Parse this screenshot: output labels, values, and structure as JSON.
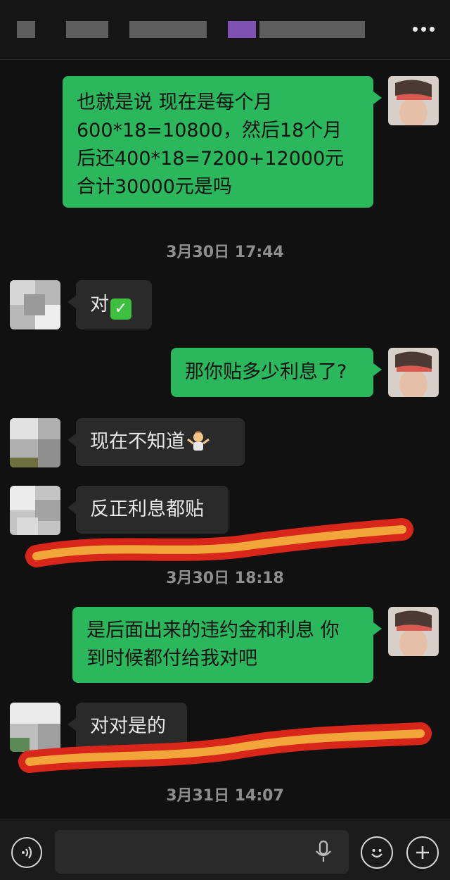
{
  "header": {
    "more_icon": "more-dots-icon"
  },
  "messages": [
    {
      "side": "self",
      "text": "也就是说 现在是每个月\n600*18=10800，然后18个月\n后还400*18=7200+12000元\n合计30000元是吗"
    },
    {
      "side": "other",
      "text": "对"
    },
    {
      "side": "self",
      "text": "那你贴多少利息了?"
    },
    {
      "side": "other",
      "text": "现在不知道"
    },
    {
      "side": "other",
      "text": "反正利息都贴"
    },
    {
      "side": "self",
      "text": "是后面出来的违约金和利息 你\n到时候都付给我对吧"
    },
    {
      "side": "other",
      "text": "对对是的"
    }
  ],
  "timestamps": [
    "3月30日 17:44",
    "3月30日 18:18",
    "3月31日 14:07"
  ],
  "input_bar": {
    "placeholder": "",
    "voice_icon": "voice-mode-icon",
    "mic_icon": "microphone-icon",
    "emoji_icon": "emoji-icon",
    "plus_icon": "plus-icon"
  },
  "colors": {
    "self_bubble": "#2bb75c",
    "other_bubble": "#2a2a2a",
    "background": "#111111",
    "highlight_red": "#d8261a",
    "highlight_orange": "#f2a53a"
  }
}
